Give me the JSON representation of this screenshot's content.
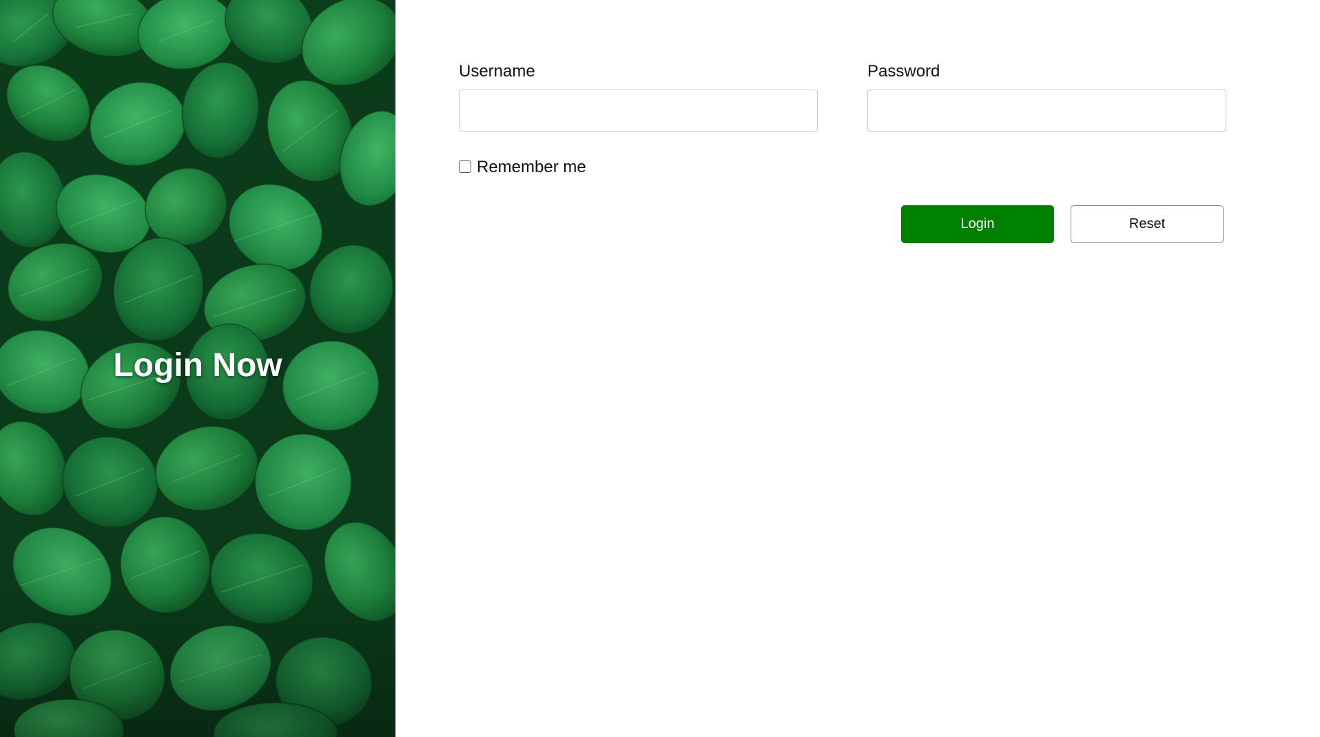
{
  "hero": {
    "title": "Login Now",
    "image": "green-leaves-background"
  },
  "form": {
    "username_label": "Username",
    "username_value": "",
    "username_placeholder": "",
    "password_label": "Password",
    "password_value": "",
    "password_placeholder": "",
    "remember_label": "Remember me",
    "remember_checked": false,
    "login_label": "Login",
    "reset_label": "Reset"
  },
  "colors": {
    "accent": "#008000",
    "hero_green": "#1f8a3f"
  }
}
